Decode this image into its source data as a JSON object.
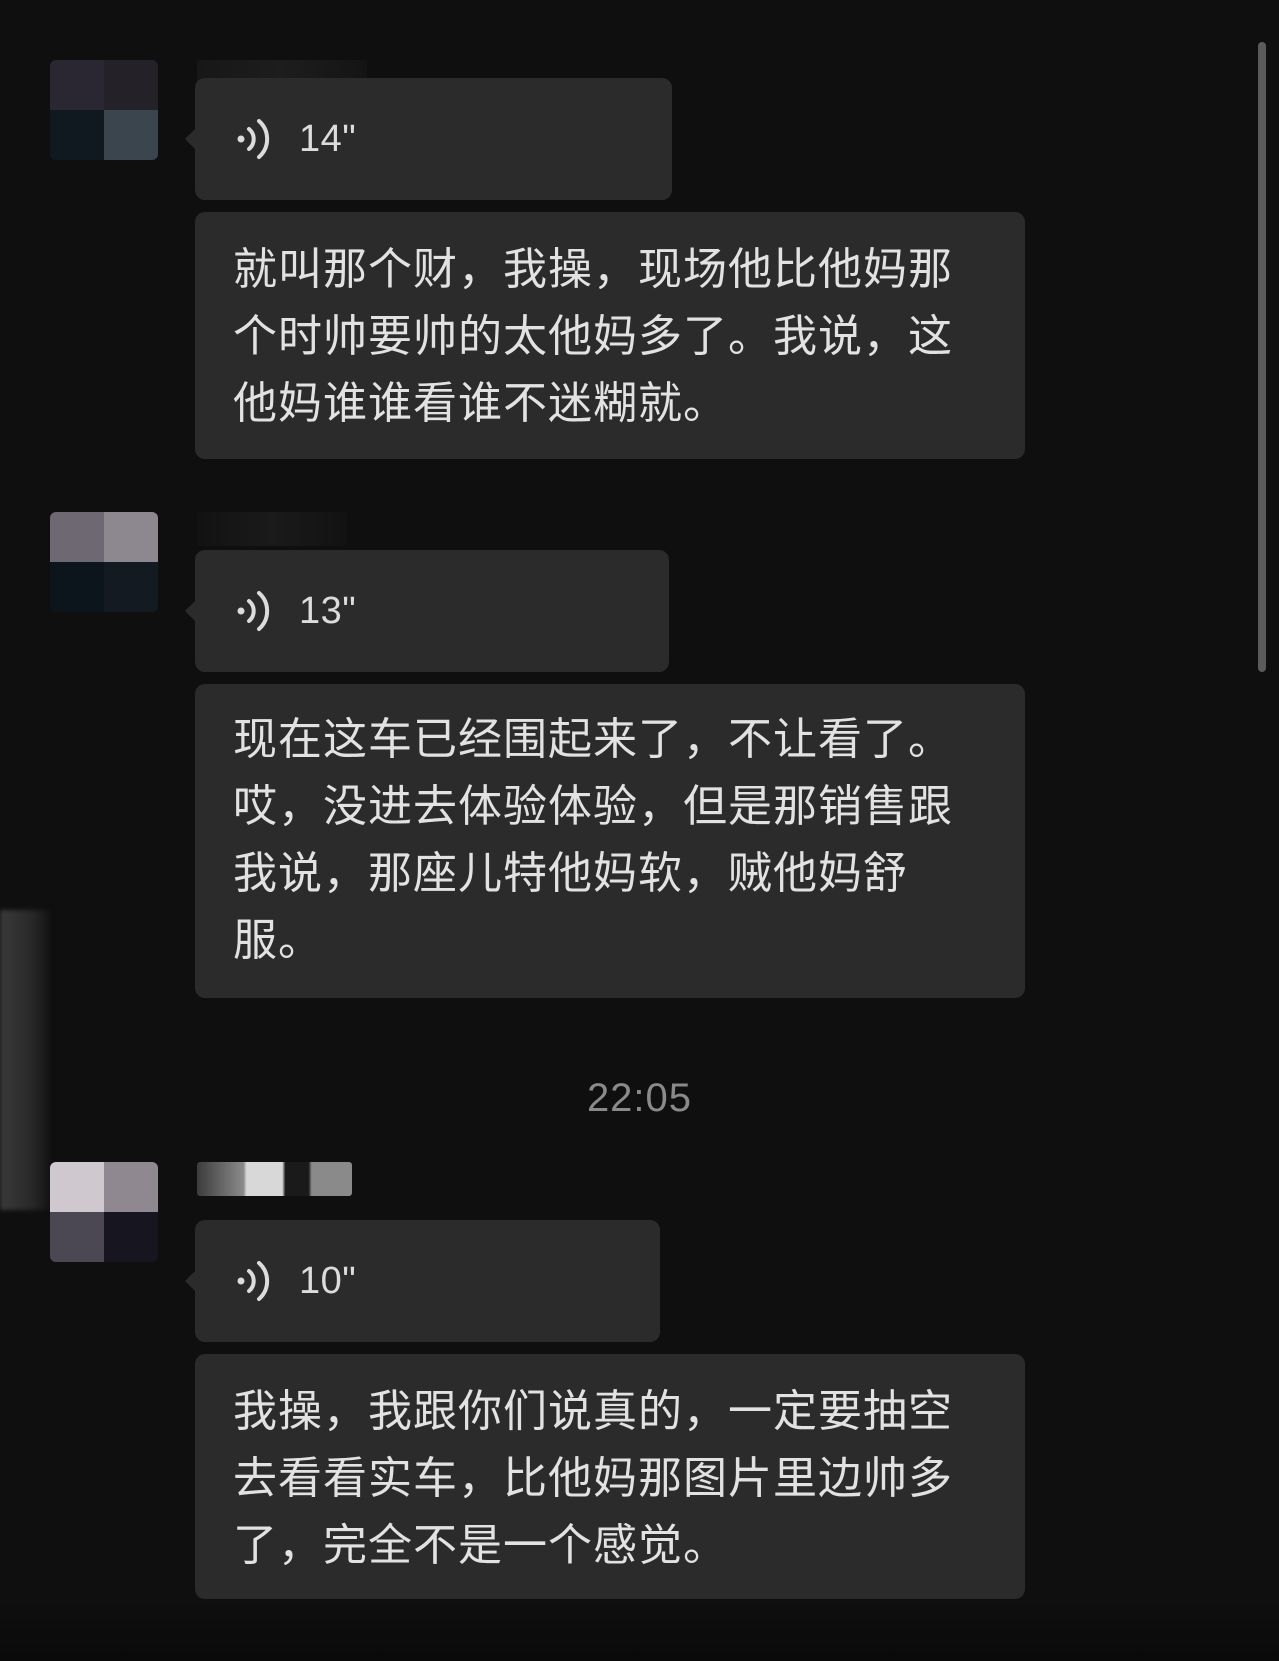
{
  "colors": {
    "background": "#0f0f0f",
    "bubble": "#2b2b2b",
    "text": "#e2e2e2",
    "timestamp": "#8a8a8a"
  },
  "messages": [
    {
      "voice_duration": "14\"",
      "text": "就叫那个财，我操，现场他比他妈那个时帅要帅的太他妈多了。我说，这他妈谁谁看谁不迷糊就。"
    },
    {
      "voice_duration": "13\"",
      "text": "现在这车已经围起来了，不让看了。哎，没进去体验体验，但是那销售跟我说，那座儿特他妈软，贼他妈舒服。"
    },
    {
      "voice_duration": "10\"",
      "text": "我操，我跟你们说真的，一定要抽空去看看实车，比他妈那图片里边帅多了，完全不是一个感觉。"
    }
  ],
  "timestamp": "22:05",
  "icons": {
    "voice": "voice-wave-icon"
  }
}
